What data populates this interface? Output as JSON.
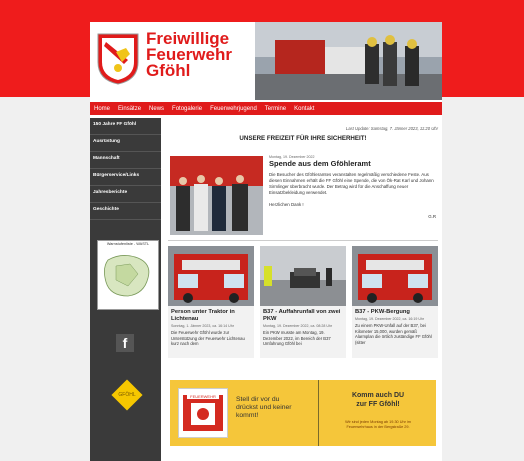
{
  "brand": {
    "line1": "Freiwillige",
    "line2": "Feuerwehr",
    "line3": "Gföhl",
    "accent_color": "#e01b1b"
  },
  "nav": {
    "items": [
      "Home",
      "Einsätze",
      "News",
      "Fotogalerie",
      "Feuerwehrjugend",
      "Termine",
      "Kontakt"
    ]
  },
  "sidebar": {
    "items": [
      "150 Jahre FF Gföhl",
      "Ausrüstung",
      "Mannschaft",
      "Bürgerservice/Links",
      "Jahresberichte",
      "Geschichte"
    ],
    "widget_title": "Warnstufenliste - WASTL",
    "facebook_glyph": "f",
    "gfoehl_label": "GFÖHL"
  },
  "content": {
    "last_update": "Last Update: Samstag, 7. Jänner 2023, 11:20 Uhr",
    "headline": "UNSERE FREIZEIT FÜR IHRE SICHERHEIT!",
    "article": {
      "meta": "Montag, 19. Dezember 2022",
      "title": "Spende aus dem Gföhleramt",
      "body": "Die Besucher des Gföhleramtes veranstalten regelmäßig verschiedene Feste. Aus diesen Einnahmen erhält die FF Gföhl eine Spende, die von Ök-Rat Karl und Johann Sirmlinger überbracht wurde. Der Betrag wird für die Anschaffung neuer Einsatzbekleidung verwendet.",
      "sign": "Herzlichen Dank !",
      "initials": "G.R"
    },
    "cards": [
      {
        "title": "Person unter Traktor in Lichtenau",
        "meta": "Sonntag, 1. Jänner 2023, ca. 16:14 Uhr",
        "body": "Die Feuerwehr Gföhl wurde zur Unterstützung der Feuerwehr Lichtenau kurz nach dem"
      },
      {
        "title": "B37 - Auffahrunfall von zwei PKW",
        "meta": "Montag, 19. Dezember 2022, ca. 08:28 Uhr",
        "body": "Ein PKW musste am Montag, 19. Dezember 2022, im Bereich der B37 Umfahrung Gföhl bei"
      },
      {
        "title": "B37 - PKW-Bergung",
        "meta": "Montag, 19. Dezember 2022, ca. 16:19 Uhr",
        "body": "Zu einem PKW-Unfall auf der B37, bei Kilometer 15,000, wurden gemäß Alarmplan die örtlich zuständige FF Gföhl (sitter"
      }
    ],
    "banner": {
      "left_text_1": "Stell dir vor du",
      "left_text_2": "drückst und keiner",
      "left_text_3": "kommt!",
      "right_title_1": "Komm auch DU",
      "right_title_2": "zur FF Gföhl!",
      "right_small_1": "Wir sind jeden Montag ab 19.30 Uhr im",
      "right_small_2": "Feuerwehrhaus in der Bergstraße 29.",
      "alarm_label": "FEUERWEHR"
    }
  }
}
